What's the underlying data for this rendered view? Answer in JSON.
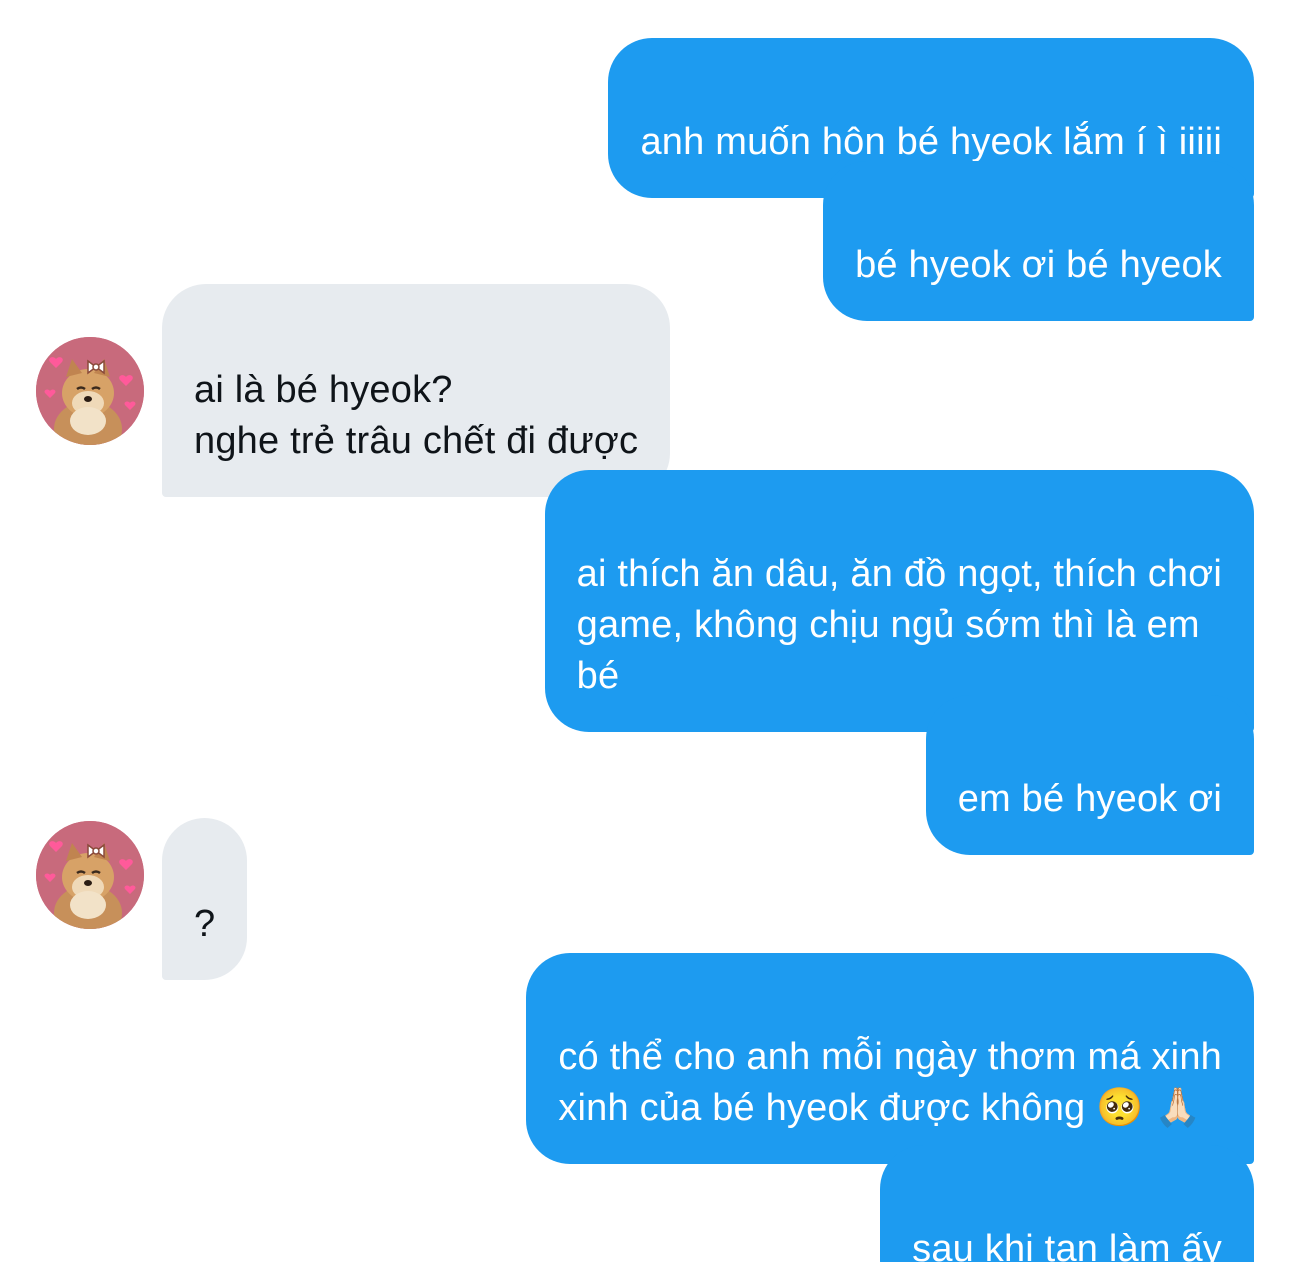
{
  "messages": [
    {
      "side": "sent",
      "text": "anh muốn hôn bé hyeok lắm í ì iiiii"
    },
    {
      "side": "sent",
      "text": "bé hyeok ơi bé hyeok"
    },
    {
      "side": "received",
      "text": "ai là bé hyeok?\nnghe trẻ trâu chết đi được"
    },
    {
      "side": "sent",
      "text": "ai thích ăn dâu, ăn đồ ngọt, thích chơi\ngame, không chịu ngủ sớm thì là em\nbé"
    },
    {
      "side": "sent",
      "text": "em bé hyeok ơi"
    },
    {
      "side": "received",
      "text": "?"
    },
    {
      "side": "sent",
      "text": "có thể cho anh mỗi ngày thơm má xinh\nxinh của bé hyeok được không 🥺 🙏🏻"
    },
    {
      "side": "sent",
      "text": "sau khi tan làm ấy"
    }
  ],
  "avatar_icon": "cheems-dog-avatar",
  "colors": {
    "sent_bubble": "#1d9bf0",
    "received_bubble": "#e7ebef",
    "sent_text": "#ffffff",
    "received_text": "#0f1419",
    "avatar_bg": "#c86a7c"
  }
}
